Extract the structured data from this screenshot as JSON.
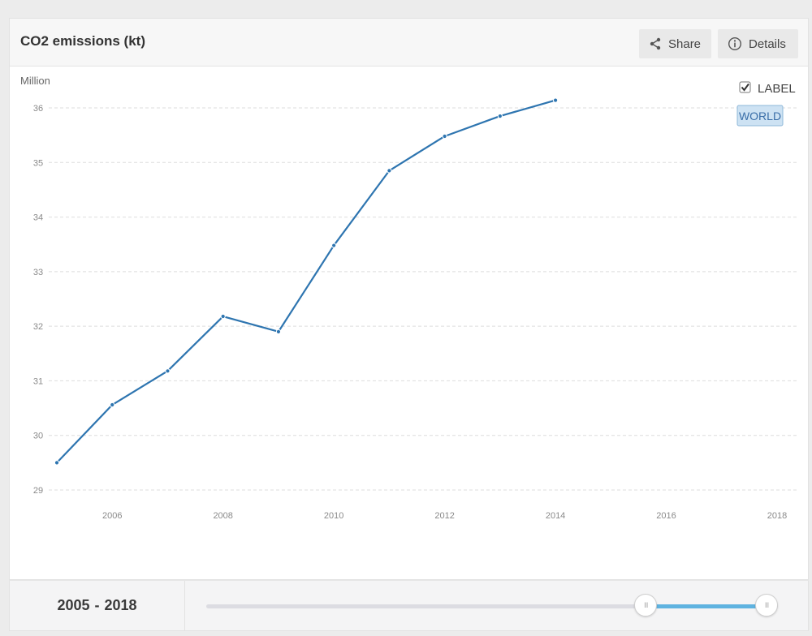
{
  "header": {
    "title": "CO2 emissions (kt)",
    "share_label": "Share",
    "details_label": "Details"
  },
  "legend": {
    "checkbox_label": "LABEL",
    "checked": true,
    "series_tag": "WORLD"
  },
  "colors": {
    "line": "#2e75b0",
    "slider_fill": "#5fb3e0",
    "world_tag_bg": "#cde2f3"
  },
  "chart_data": {
    "type": "line",
    "ylabel": "Million",
    "xlabel": "",
    "x": [
      2005,
      2006,
      2007,
      2008,
      2009,
      2010,
      2011,
      2012,
      2013,
      2014
    ],
    "series": [
      {
        "name": "WORLD",
        "values": [
          29.5,
          30.56,
          31.18,
          32.18,
          31.9,
          33.48,
          34.85,
          35.48,
          35.85,
          36.14
        ]
      }
    ],
    "xlim": [
      2005,
      2018
    ],
    "ylim": [
      29,
      36
    ],
    "x_ticks": [
      "2006",
      "2008",
      "2010",
      "2012",
      "2014",
      "2016",
      "2018"
    ],
    "y_ticks": [
      "29",
      "30",
      "31",
      "32",
      "33",
      "34",
      "35",
      "36"
    ],
    "grid": "horizontal-dashed",
    "legend_position": "top-right"
  },
  "range": {
    "start": "2005",
    "end": "2018",
    "separator": "-",
    "handle_icon": "grip-icon",
    "handle_glyph": "III",
    "selected_from_fraction": 0.78,
    "selected_to_fraction": 1.0
  }
}
